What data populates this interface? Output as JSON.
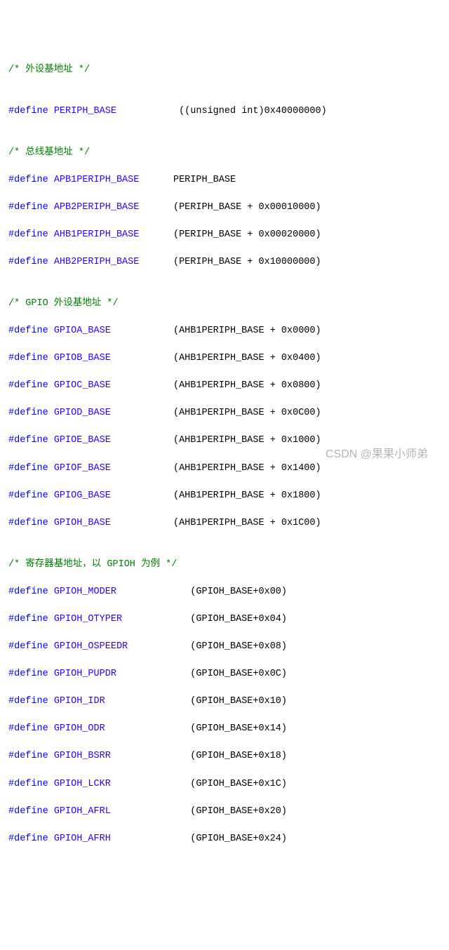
{
  "comments": {
    "c1": "/* 外设基地址 */",
    "c2": "/* 总线基地址 */",
    "c3": "/* GPIO 外设基地址 */",
    "c4": "/* 寄存器基地址，以 GPIOH 为例 */"
  },
  "defines": [
    {
      "kw": "#define",
      "name": "PERIPH_BASE",
      "pad": "           ",
      "expr": "((unsigned int)0x40000000)"
    },
    {
      "kw": "#define",
      "name": "APB1PERIPH_BASE",
      "pad": "      ",
      "expr": "PERIPH_BASE"
    },
    {
      "kw": "#define",
      "name": "APB2PERIPH_BASE",
      "pad": "      ",
      "expr": "(PERIPH_BASE + 0x00010000)"
    },
    {
      "kw": "#define",
      "name": "AHB1PERIPH_BASE",
      "pad": "      ",
      "expr": "(PERIPH_BASE + 0x00020000)"
    },
    {
      "kw": "#define",
      "name": "AHB2PERIPH_BASE",
      "pad": "      ",
      "expr": "(PERIPH_BASE + 0x10000000)"
    },
    {
      "kw": "#define",
      "name": "GPIOA_BASE",
      "pad": "           ",
      "expr": "(AHB1PERIPH_BASE + 0x0000)"
    },
    {
      "kw": "#define",
      "name": "GPIOB_BASE",
      "pad": "           ",
      "expr": "(AHB1PERIPH_BASE + 0x0400)"
    },
    {
      "kw": "#define",
      "name": "GPIOC_BASE",
      "pad": "           ",
      "expr": "(AHB1PERIPH_BASE + 0x0800)"
    },
    {
      "kw": "#define",
      "name": "GPIOD_BASE",
      "pad": "           ",
      "expr": "(AHB1PERIPH_BASE + 0x0C00)"
    },
    {
      "kw": "#define",
      "name": "GPIOE_BASE",
      "pad": "           ",
      "expr": "(AHB1PERIPH_BASE + 0x1000)"
    },
    {
      "kw": "#define",
      "name": "GPIOF_BASE",
      "pad": "           ",
      "expr": "(AHB1PERIPH_BASE + 0x1400)"
    },
    {
      "kw": "#define",
      "name": "GPIOG_BASE",
      "pad": "           ",
      "expr": "(AHB1PERIPH_BASE + 0x1800)"
    },
    {
      "kw": "#define",
      "name": "GPIOH_BASE",
      "pad": "           ",
      "expr": "(AHB1PERIPH_BASE + 0x1C00)"
    },
    {
      "kw": "#define",
      "name": "GPIOH_MODER",
      "pad": "             ",
      "expr": "(GPIOH_BASE+0x00)"
    },
    {
      "kw": "#define",
      "name": "GPIOH_OTYPER",
      "pad": "            ",
      "expr": "(GPIOH_BASE+0x04)"
    },
    {
      "kw": "#define",
      "name": "GPIOH_OSPEEDR",
      "pad": "           ",
      "expr": "(GPIOH_BASE+0x08)"
    },
    {
      "kw": "#define",
      "name": "GPIOH_PUPDR",
      "pad": "             ",
      "expr": "(GPIOH_BASE+0x0C)"
    },
    {
      "kw": "#define",
      "name": "GPIOH_IDR",
      "pad": "               ",
      "expr": "(GPIOH_BASE+0x10)"
    },
    {
      "kw": "#define",
      "name": "GPIOH_ODR",
      "pad": "               ",
      "expr": "(GPIOH_BASE+0x14)"
    },
    {
      "kw": "#define",
      "name": "GPIOH_BSRR",
      "pad": "              ",
      "expr": "(GPIOH_BASE+0x18)"
    },
    {
      "kw": "#define",
      "name": "GPIOH_LCKR",
      "pad": "              ",
      "expr": "(GPIOH_BASE+0x1C)"
    },
    {
      "kw": "#define",
      "name": "GPIOH_AFRL",
      "pad": "              ",
      "expr": "(GPIOH_BASE+0x20)"
    },
    {
      "kw": "#define",
      "name": "GPIOH_AFRH",
      "pad": "              ",
      "expr": "(GPIOH_BASE+0x24)"
    }
  ],
  "watermark": "CSDN @果果小师弟"
}
